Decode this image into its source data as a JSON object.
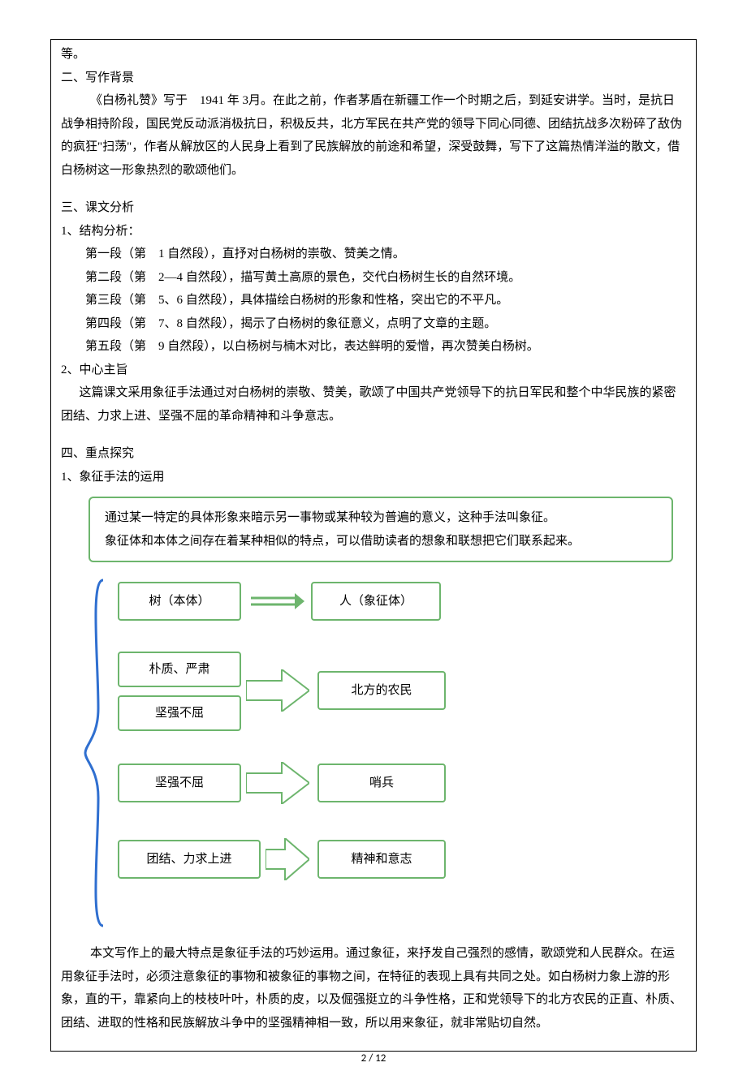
{
  "top": {
    "cont": "等。",
    "h2": "二、写作背景",
    "p2": "《白杨礼赞》写于　1941 年 3月。在此之前，作者茅盾在新疆工作一个时期之后，到延安讲学。当时，是抗日战争相持阶段，国民党反动派消极抗日，积极反共，北方军民在共产党的领导下同心同德、团结抗战多次粉碎了敌伪的疯狂\"扫荡\"，作者从解放区的人民身上看到了民族解放的前途和希望，深受鼓舞，写下了这篇热情洋溢的散文，借白杨树这一形象热烈的歌颂他们。"
  },
  "sec3": {
    "h": "三、课文分析",
    "s1h": "1、结构分析：",
    "lines": [
      "第一段（第　1 自然段），直抒对白杨树的崇敬、赞美之情。",
      "第二段（第　2—4 自然段），描写黄土高原的景色，交代白杨树生长的自然环境。",
      "第三段（第　5、6 自然段），具体描绘白杨树的形象和性格，突出它的不平凡。",
      "第四段（第　7、8 自然段），揭示了白杨树的象征意义，点明了文章的主题。",
      "第五段（第　9 自然段），以白杨树与楠木对比，表达鲜明的爱憎，再次赞美白杨树。"
    ],
    "s2h": "2、中心主旨",
    "s2p": "这篇课文采用象征手法通过对白杨树的崇敬、赞美，歌颂了中国共产党领导下的抗日军民和整个中华民族的紧密团结、力求上进、坚强不屈的革命精神和斗争意志。"
  },
  "sec4": {
    "h": "四、重点探究",
    "s1h": "1、象征手法的运用",
    "box": {
      "l1": "通过某一特定的具体形象来暗示另一事物或某种较为普遍的意义，这种手法叫象征。",
      "l2": "象征体和本体之间存在着某种相似的特点，可以借助读者的想象和联想把它们联系起来。"
    },
    "diagram": {
      "left1": "树（本体）",
      "right1": "人（象征体）",
      "left2a": "朴质、严肃",
      "left2b": "坚强不屈",
      "right2": "北方的农民",
      "left3": "坚强不屈",
      "right3": "哨兵",
      "left4": "团结、力求上进",
      "right4": "精神和意志"
    },
    "p": "本文写作上的最大特点是象征手法的巧妙运用。通过象征，来抒发自己强烈的感情，歌颂党和人民群众。在运用象征手法时，必须注意象征的事物和被象征的事物之间，在特征的表现上具有共同之处。如白杨树力象上游的形象，直的干，靠紧向上的枝枝叶叶，朴质的皮，以及倔强挺立的斗争性格，正和党领导下的北方农民的正直、朴质、团结、进取的性格和民族解放斗争中的坚强精神相一致，所以用来象征，就非常贴切自然。"
  },
  "footer": {
    "page": "2",
    "sep": "/",
    "total": "12"
  }
}
